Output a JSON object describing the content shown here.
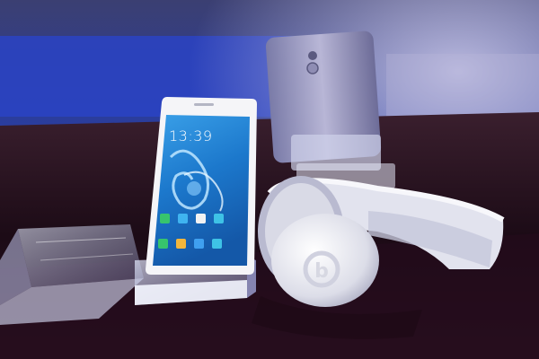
{
  "phone_screen": {
    "clock": "13:39"
  },
  "headphones": {
    "logo_text": "b"
  },
  "colors": {
    "background_blue": "#2b40b8",
    "table_dark": "#1a0b14",
    "phone_screen_blue": "#1f7fd1",
    "headphone_white": "#e8e8ef"
  }
}
